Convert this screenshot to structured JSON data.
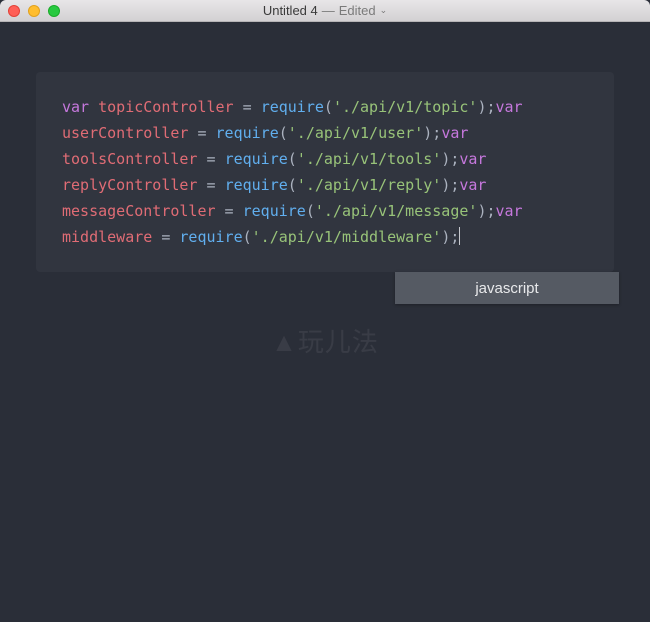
{
  "titlebar": {
    "doc_name": "Untitled 4",
    "separator": "—",
    "status": "Edited"
  },
  "code": {
    "kw": "var",
    "vars": {
      "topic": "topicController",
      "user": "userController",
      "tools": "toolsController",
      "reply": "replyController",
      "message": "messageController",
      "middleware": "middleware"
    },
    "fn": "require",
    "paths": {
      "topic": "'./api/v1/topic'",
      "user": "'./api/v1/user'",
      "tools": "'./api/v1/tools'",
      "reply": "'./api/v1/reply'",
      "message": "'./api/v1/message'",
      "middleware": "'./api/v1/middleware'"
    },
    "eq": " = ",
    "op": "(",
    "cp": ");"
  },
  "tooltip": {
    "label": "javascript"
  },
  "watermark": "▲玩儿法"
}
